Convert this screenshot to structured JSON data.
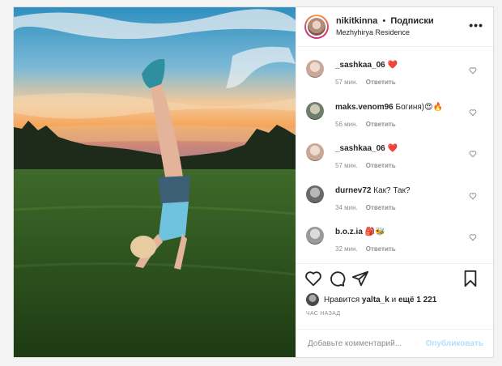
{
  "post": {
    "username": "nikitkinna",
    "separator": "•",
    "follow_label": "Подписки",
    "location": "Mezhyhirya Residence",
    "more_label": "•••"
  },
  "comments": [
    {
      "user": "_sashkaa_06",
      "text": "❤️",
      "time": "57 мин.",
      "reply": "Ответить",
      "avatar_color": "#c8a898"
    },
    {
      "user": "maks.venom96",
      "text": "Богиня)😍🔥",
      "time": "56 мин.",
      "reply": "Ответить",
      "avatar_color": "#6f7d6c"
    },
    {
      "user": "_sashkaa_06",
      "text": "❤️",
      "time": "57 мин.",
      "reply": "Ответить",
      "avatar_color": "#c8a898"
    },
    {
      "user": "durnev72",
      "text": "Как? Так?",
      "time": "34 мин.",
      "reply": "Ответить",
      "avatar_color": "#6a6a6a"
    },
    {
      "user": "b.o.z.ia",
      "text": "🎒🐝",
      "time": "32 мин.",
      "reply": "Ответить",
      "avatar_color": "#9a9a9a"
    }
  ],
  "likes": {
    "prefix": "Нравится",
    "user": "yalta_k",
    "mid": "и",
    "rest": "ещё 1 221"
  },
  "time_ago": "ЧАС НАЗАД",
  "add_comment": {
    "placeholder": "Добавьте комментарий...",
    "publish_label": "Опубликовать"
  },
  "icons": {
    "like": "heart-icon",
    "comment": "comment-icon",
    "share": "share-icon",
    "save": "bookmark-icon"
  }
}
